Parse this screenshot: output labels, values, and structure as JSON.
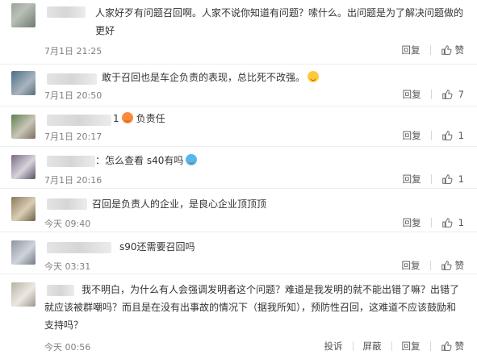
{
  "comments": [
    {
      "text": "人家好歹有问题召回啊。人家不说你知道有问题？嗦什么。出问题是为了解决问题做的更好",
      "time": "7月1日 21:25",
      "reply": "回复",
      "like": "赞",
      "likes": ""
    },
    {
      "text": "敢于召回也是车企负责的表现，总比死不改强。",
      "time": "7月1日 20:50",
      "reply": "回复",
      "like": "",
      "likes": "7"
    },
    {
      "text": "1",
      "text2": "负责任",
      "time": "7月1日 20:17",
      "reply": "回复",
      "like": "",
      "likes": "1"
    },
    {
      "text": "：怎么查看  s40有吗",
      "time": "7月1日 20:16",
      "reply": "回复",
      "like": "",
      "likes": "1"
    },
    {
      "text": "召回是负责人的企业，是良心企业顶顶顶",
      "time": "今天 09:40",
      "reply": "回复",
      "like": "",
      "likes": "1"
    },
    {
      "text": "s90还需要召回吗",
      "time": "今天 03:31",
      "reply": "回复",
      "like": "赞",
      "likes": ""
    },
    {
      "text": "我不明白，为什么有人会强调发明者这个问题？难道是我发明的就不能出错了嘛？出错了就应该被群嘲吗？而且是在没有出事故的情况下（据我所知），预防性召回，这难道不应该鼓励和支持吗？",
      "time": "今天 00:56",
      "report": "投诉",
      "block": "屏蔽",
      "reply": "回复",
      "like": "赞",
      "likes": ""
    }
  ]
}
